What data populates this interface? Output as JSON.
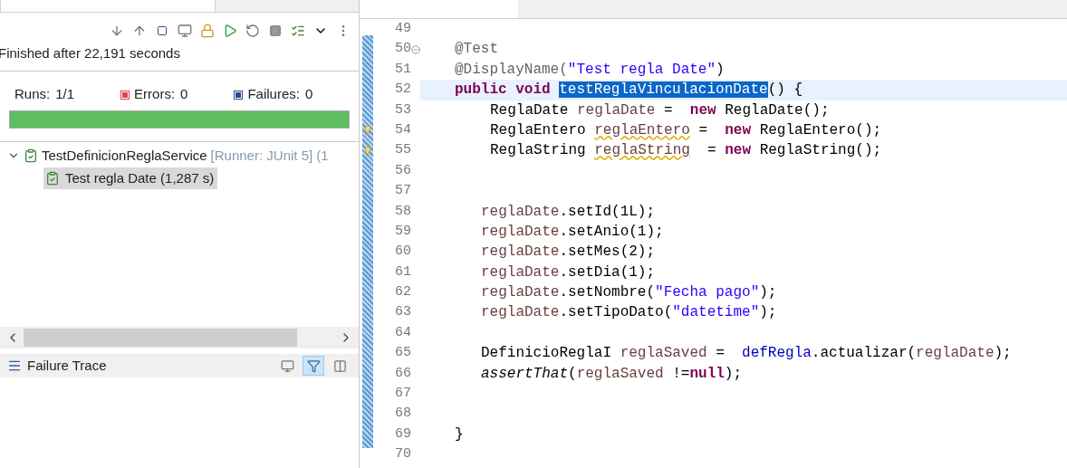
{
  "left_panel": {
    "status": "Finished after 22,191 seconds",
    "counters": [
      {
        "kind": "runs",
        "label": "Runs:",
        "value": "1/1"
      },
      {
        "kind": "errors",
        "label": "Errors:",
        "value": "0"
      },
      {
        "kind": "failures",
        "label": "Failures:",
        "value": "0"
      }
    ],
    "progress": {
      "level": 1
    },
    "tree": [
      {
        "label": "TestDefinicionReglaService",
        "detail": "[Runner: JUnit 5] (1",
        "expanded": true,
        "selected": false,
        "children": [
          {
            "label": "Test regla Date (1,287 s)",
            "selected": true
          }
        ]
      }
    ],
    "failure_trace": {
      "title": "Failure Trace"
    }
  },
  "editor": {
    "lines": [
      {
        "number": "49",
        "current": false,
        "warning": false,
        "foldable": false
      },
      {
        "number": "50",
        "current": false,
        "warning": false,
        "foldable": true,
        "kind": "member",
        "tokens": [
          {
            "text": "@Test",
            "kind": "annotation"
          }
        ]
      },
      {
        "number": "51",
        "current": false,
        "warning": false,
        "foldable": false,
        "kind": "member",
        "tokens": [
          {
            "text": "@DisplayName(",
            "kind": "annotation"
          },
          {
            "text": "\"Test regla Date\"",
            "kind": "string"
          },
          {
            "text": ")",
            "kind": "plain"
          }
        ]
      },
      {
        "number": "52",
        "current": true,
        "warning": false,
        "foldable": false,
        "kind": "member",
        "tokens": [
          {
            "text": "public ",
            "kind": "keyword"
          },
          {
            "text": "void ",
            "kind": "keyword"
          },
          {
            "text": "testReglaVinculacionDate",
            "kind": "selection"
          },
          {
            "text": "() {",
            "kind": "plain"
          }
        ]
      },
      {
        "number": "53",
        "current": false,
        "warning": false,
        "foldable": false,
        "kind": "declaration",
        "tokens": [
          {
            "text": "ReglaDate ",
            "kind": "plain"
          },
          {
            "text": "reglaDate",
            "kind": "local"
          },
          {
            "text": " =  ",
            "kind": "plain"
          },
          {
            "text": "new",
            "kind": "keyword"
          },
          {
            "text": " ReglaDate();",
            "kind": "plain"
          }
        ]
      },
      {
        "number": "54",
        "current": false,
        "warning": true,
        "foldable": false,
        "kind": "declaration",
        "tokens": [
          {
            "text": "ReglaEntero ",
            "kind": "plain"
          },
          {
            "text": "reglaEntero",
            "kind": "unused"
          },
          {
            "text": " =  ",
            "kind": "plain"
          },
          {
            "text": "new",
            "kind": "keyword"
          },
          {
            "text": " ReglaEntero();",
            "kind": "plain"
          }
        ]
      },
      {
        "number": "55",
        "current": false,
        "warning": true,
        "foldable": false,
        "kind": "declaration",
        "tokens": [
          {
            "text": "ReglaString ",
            "kind": "plain"
          },
          {
            "text": "reglaString",
            "kind": "unused"
          },
          {
            "text": "  = ",
            "kind": "plain"
          },
          {
            "text": "new",
            "kind": "keyword"
          },
          {
            "text": " ReglaString();",
            "kind": "plain"
          }
        ]
      },
      {
        "number": "56",
        "current": false,
        "warning": false,
        "foldable": false
      },
      {
        "number": "57",
        "current": false,
        "warning": false,
        "foldable": false
      },
      {
        "number": "58",
        "current": false,
        "warning": false,
        "foldable": false,
        "kind": "statement",
        "tokens": [
          {
            "text": "reglaDate",
            "kind": "local"
          },
          {
            "text": ".setId(1L);",
            "kind": "plain"
          }
        ]
      },
      {
        "number": "59",
        "current": false,
        "warning": false,
        "foldable": false,
        "kind": "statement",
        "tokens": [
          {
            "text": "reglaDate",
            "kind": "local"
          },
          {
            "text": ".setAnio(1);",
            "kind": "plain"
          }
        ]
      },
      {
        "number": "60",
        "current": false,
        "warning": false,
        "foldable": false,
        "kind": "statement",
        "tokens": [
          {
            "text": "reglaDate",
            "kind": "local"
          },
          {
            "text": ".setMes(2);",
            "kind": "plain"
          }
        ]
      },
      {
        "number": "61",
        "current": false,
        "warning": false,
        "foldable": false,
        "kind": "statement",
        "tokens": [
          {
            "text": "reglaDate",
            "kind": "local"
          },
          {
            "text": ".setDia(1);",
            "kind": "plain"
          }
        ]
      },
      {
        "number": "62",
        "current": false,
        "warning": false,
        "foldable": false,
        "kind": "statement",
        "tokens": [
          {
            "text": "reglaDate",
            "kind": "local"
          },
          {
            "text": ".setNombre(",
            "kind": "plain"
          },
          {
            "text": "\"Fecha pago\"",
            "kind": "string"
          },
          {
            "text": ");",
            "kind": "plain"
          }
        ]
      },
      {
        "number": "63",
        "current": false,
        "warning": false,
        "foldable": false,
        "kind": "statement",
        "tokens": [
          {
            "text": "reglaDate",
            "kind": "local"
          },
          {
            "text": ".setTipoDato(",
            "kind": "plain"
          },
          {
            "text": "\"datetime\"",
            "kind": "string"
          },
          {
            "text": ");",
            "kind": "plain"
          }
        ]
      },
      {
        "number": "64",
        "current": false,
        "warning": false,
        "foldable": false
      },
      {
        "number": "65",
        "current": false,
        "warning": false,
        "foldable": false,
        "kind": "statement",
        "tokens": [
          {
            "text": "DefinicioReglaI ",
            "kind": "plain"
          },
          {
            "text": "reglaSaved",
            "kind": "local"
          },
          {
            "text": " =  ",
            "kind": "plain"
          },
          {
            "text": "defRegla",
            "kind": "field"
          },
          {
            "text": ".actualizar(",
            "kind": "plain"
          },
          {
            "text": "reglaDate",
            "kind": "local"
          },
          {
            "text": ");",
            "kind": "plain"
          }
        ]
      },
      {
        "number": "66",
        "current": false,
        "warning": false,
        "foldable": false,
        "kind": "statement",
        "tokens": [
          {
            "text": "assertThat",
            "kind": "static"
          },
          {
            "text": "(",
            "kind": "plain"
          },
          {
            "text": "reglaSaved",
            "kind": "local"
          },
          {
            "text": " !=",
            "kind": "plain"
          },
          {
            "text": "null",
            "kind": "keyword"
          },
          {
            "text": ");",
            "kind": "plain"
          }
        ]
      },
      {
        "number": "67",
        "current": false,
        "warning": false,
        "foldable": false
      },
      {
        "number": "68",
        "current": false,
        "warning": false,
        "foldable": false
      },
      {
        "number": "69",
        "current": false,
        "warning": false,
        "foldable": false,
        "kind": "member",
        "tokens": [
          {
            "text": "}",
            "kind": "plain"
          }
        ]
      },
      {
        "number": "70",
        "current": false,
        "warning": false,
        "foldable": false
      }
    ]
  }
}
